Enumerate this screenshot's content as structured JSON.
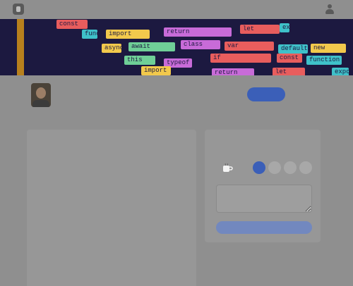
{
  "header": {
    "logo_icon": "buymeacoffee-logo-icon",
    "account_icon": "user-account-icon"
  },
  "banner": {
    "tags": [
      {
        "text": "const",
        "color": "#e85d5d"
      },
      {
        "text": "function",
        "color": "#3fc1c9"
      },
      {
        "text": "import",
        "color": "#f2c94c"
      },
      {
        "text": "return",
        "color": "#c86bd8"
      },
      {
        "text": "let",
        "color": "#e85d5d"
      },
      {
        "text": "export",
        "color": "#3fc1c9"
      },
      {
        "text": "async",
        "color": "#f2c94c"
      },
      {
        "text": "await",
        "color": "#6fcf97"
      },
      {
        "text": "class",
        "color": "#c86bd8"
      },
      {
        "text": "var",
        "color": "#e85d5d"
      },
      {
        "text": "default",
        "color": "#3fc1c9"
      },
      {
        "text": "new",
        "color": "#f2c94c"
      },
      {
        "text": "this",
        "color": "#6fcf97"
      },
      {
        "text": "typeof",
        "color": "#c86bd8"
      },
      {
        "text": "if",
        "color": "#e85d5d"
      }
    ]
  },
  "profile": {
    "name": "",
    "tagline": "",
    "support_label": "",
    "share_label": ""
  },
  "about": {
    "intro": "",
    "links": [
      "",
      "",
      "",
      "",
      ""
    ],
    "para2": "",
    "para3": "",
    "rows": [
      {
        "label": "",
        "value": ""
      },
      {
        "label": "",
        "value": ""
      }
    ]
  },
  "support_card": {
    "title": "",
    "message_placeholder": "",
    "button_label": "",
    "amount_colors": [
      "#3b5fb8",
      "#a8a8a8",
      "#a8a8a8",
      "#a8a8a8"
    ]
  }
}
